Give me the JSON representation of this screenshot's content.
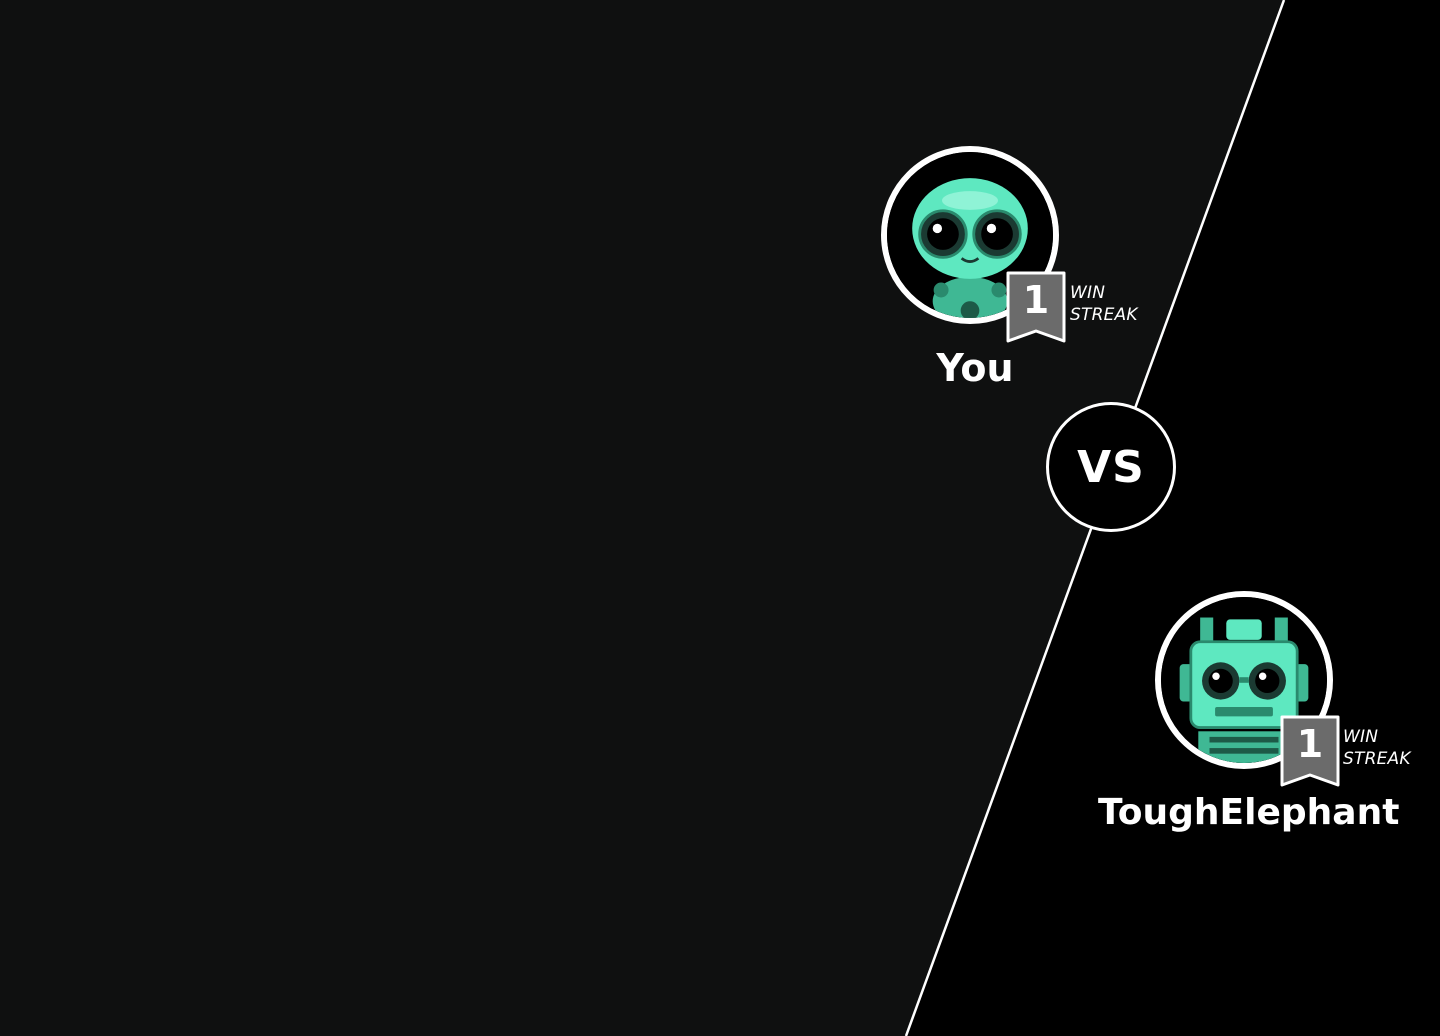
{
  "players": {
    "you": {
      "name": "You",
      "win_streak": "1",
      "streak_label": "WIN\nSTREAK",
      "avatar": "green-alien-robot-icon"
    },
    "opponent": {
      "name": "ToughElephant",
      "win_streak": "1",
      "streak_label": "WIN\nSTREAK",
      "avatar": "green-boxy-robot-icon"
    }
  },
  "versus_label": "VS",
  "colors": {
    "left_background": "#0f1010",
    "right_background": "#000000",
    "accent": "#5ee8c0",
    "badge": "#6b6b6b"
  }
}
